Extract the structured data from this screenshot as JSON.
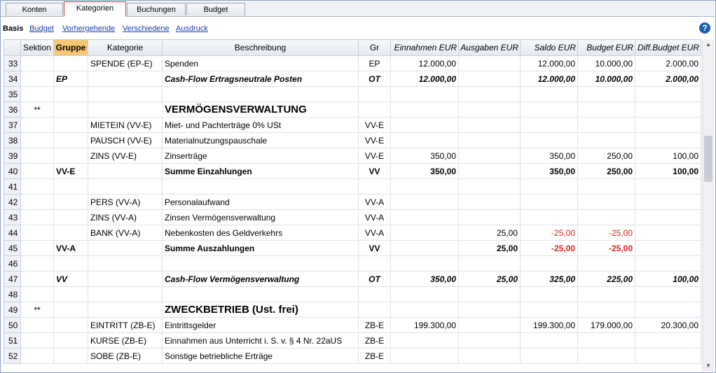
{
  "tabs": [
    "Konten",
    "Kategorien",
    "Buchungen",
    "Budget"
  ],
  "subtabs": {
    "basis": "Basis",
    "links": [
      "Budget",
      "Vorhergehende",
      "Verschiedene",
      "Ausdruck"
    ]
  },
  "help_label": "?",
  "columns": {
    "sektion": "Sektion",
    "gruppe": "Gruppe",
    "kategorie": "Kategorie",
    "beschreibung": "Beschreibung",
    "gr": "Gr",
    "einnahmen": "Einnahmen EUR",
    "ausgaben": "Ausgaben EUR",
    "saldo": "Saldo EUR",
    "budget": "Budget EUR",
    "diff": "Diff.Budget EUR"
  },
  "colors": {
    "accent": "#f6c775",
    "negative": "#e02020",
    "link": "#1a3fa8"
  },
  "scrollbar": {
    "up_icon": "▲",
    "down_icon": "▼"
  },
  "rows": [
    {
      "n": "33",
      "sek": "",
      "grp": "",
      "kat": "SPENDE (EP-E)",
      "bes": "Spenden",
      "gr": "EP",
      "ein": "12.000,00",
      "aus": "",
      "sal": "12.000,00",
      "bud": "10.000,00",
      "dif": "2.000,00",
      "style": ""
    },
    {
      "n": "34",
      "sek": "",
      "grp": "EP",
      "kat": "",
      "bes": "Cash-Flow Ertragsneutrale Posten",
      "gr": "OT",
      "ein": "12.000,00",
      "aus": "",
      "sal": "12.000,00",
      "bud": "10.000,00",
      "dif": "2.000,00",
      "style": "bi"
    },
    {
      "n": "35",
      "sek": "",
      "grp": "",
      "kat": "",
      "bes": "",
      "gr": "",
      "ein": "",
      "aus": "",
      "sal": "",
      "bud": "",
      "dif": "",
      "style": ""
    },
    {
      "n": "36",
      "sek": "**",
      "grp": "",
      "kat": "",
      "bes": "VERMÖGENSVERWALTUNG",
      "gr": "",
      "ein": "",
      "aus": "",
      "sal": "",
      "bud": "",
      "dif": "",
      "style": "h"
    },
    {
      "n": "37",
      "sek": "",
      "grp": "",
      "kat": "MIETEIN (VV-E)",
      "bes": "Miet- und Pachterträge 0% USt",
      "gr": "VV-E",
      "ein": "",
      "aus": "",
      "sal": "",
      "bud": "",
      "dif": "",
      "style": ""
    },
    {
      "n": "38",
      "sek": "",
      "grp": "",
      "kat": "PAUSCH (VV-E)",
      "bes": "Materialnutzungspauschale",
      "gr": "VV-E",
      "ein": "",
      "aus": "",
      "sal": "",
      "bud": "",
      "dif": "",
      "style": ""
    },
    {
      "n": "39",
      "sek": "",
      "grp": "",
      "kat": "ZINS (VV-E)",
      "bes": "Zinserträge",
      "gr": "VV-E",
      "ein": "350,00",
      "aus": "",
      "sal": "350,00",
      "bud": "250,00",
      "dif": "100,00",
      "style": ""
    },
    {
      "n": "40",
      "sek": "",
      "grp": "VV-E",
      "kat": "",
      "bes": "Summe Einzahlungen",
      "gr": "VV",
      "ein": "350,00",
      "aus": "",
      "sal": "350,00",
      "bud": "250,00",
      "dif": "100,00",
      "style": "b"
    },
    {
      "n": "41",
      "sek": "",
      "grp": "",
      "kat": "",
      "bes": "",
      "gr": "",
      "ein": "",
      "aus": "",
      "sal": "",
      "bud": "",
      "dif": "",
      "style": ""
    },
    {
      "n": "42",
      "sek": "",
      "grp": "",
      "kat": "PERS (VV-A)",
      "bes": "Personalaufwand",
      "gr": "VV-A",
      "ein": "",
      "aus": "",
      "sal": "",
      "bud": "",
      "dif": "",
      "style": ""
    },
    {
      "n": "43",
      "sek": "",
      "grp": "",
      "kat": "ZINS (VV-A)",
      "bes": "Zinsen Vermögensverwaltung",
      "gr": "VV-A",
      "ein": "",
      "aus": "",
      "sal": "",
      "bud": "",
      "dif": "",
      "style": ""
    },
    {
      "n": "44",
      "sek": "",
      "grp": "",
      "kat": "BANK (VV-A)",
      "bes": "Nebenkosten des Geldverkehrs",
      "gr": "VV-A",
      "ein": "",
      "aus": "25,00",
      "sal": "-25,00",
      "bud": "-25,00",
      "dif": "",
      "style": ""
    },
    {
      "n": "45",
      "sek": "",
      "grp": "VV-A",
      "kat": "",
      "bes": "Summe Auszahlungen",
      "gr": "VV",
      "ein": "",
      "aus": "25,00",
      "sal": "-25,00",
      "bud": "-25,00",
      "dif": "",
      "style": "b"
    },
    {
      "n": "46",
      "sek": "",
      "grp": "",
      "kat": "",
      "bes": "",
      "gr": "",
      "ein": "",
      "aus": "",
      "sal": "",
      "bud": "",
      "dif": "",
      "style": ""
    },
    {
      "n": "47",
      "sek": "",
      "grp": "VV",
      "kat": "",
      "bes": "Cash-Flow Vermögensverwaltung",
      "gr": "OT",
      "ein": "350,00",
      "aus": "25,00",
      "sal": "325,00",
      "bud": "225,00",
      "dif": "100,00",
      "style": "bi"
    },
    {
      "n": "48",
      "sek": "",
      "grp": "",
      "kat": "",
      "bes": "",
      "gr": "",
      "ein": "",
      "aus": "",
      "sal": "",
      "bud": "",
      "dif": "",
      "style": ""
    },
    {
      "n": "49",
      "sek": "**",
      "grp": "",
      "kat": "",
      "bes": "ZWECKBETRIEB (Ust. frei)",
      "gr": "",
      "ein": "",
      "aus": "",
      "sal": "",
      "bud": "",
      "dif": "",
      "style": "h"
    },
    {
      "n": "50",
      "sek": "",
      "grp": "",
      "kat": "EINTRITT (ZB-E)",
      "bes": "Eintrittsgelder",
      "gr": "ZB-E",
      "ein": "199.300,00",
      "aus": "",
      "sal": "199.300,00",
      "bud": "179.000,00",
      "dif": "20.300,00",
      "style": ""
    },
    {
      "n": "51",
      "sek": "",
      "grp": "",
      "kat": "KURSE (ZB-E)",
      "bes": "Einnahmen aus Unterricht i. S. v. § 4 Nr. 22aUS",
      "gr": "ZB-E",
      "ein": "",
      "aus": "",
      "sal": "",
      "bud": "",
      "dif": "",
      "style": ""
    },
    {
      "n": "52",
      "sek": "",
      "grp": "",
      "kat": "SOBE (ZB-E)",
      "bes": "Sonstige betriebliche Erträge",
      "gr": "ZB-E",
      "ein": "",
      "aus": "",
      "sal": "",
      "bud": "",
      "dif": "",
      "style": ""
    }
  ]
}
